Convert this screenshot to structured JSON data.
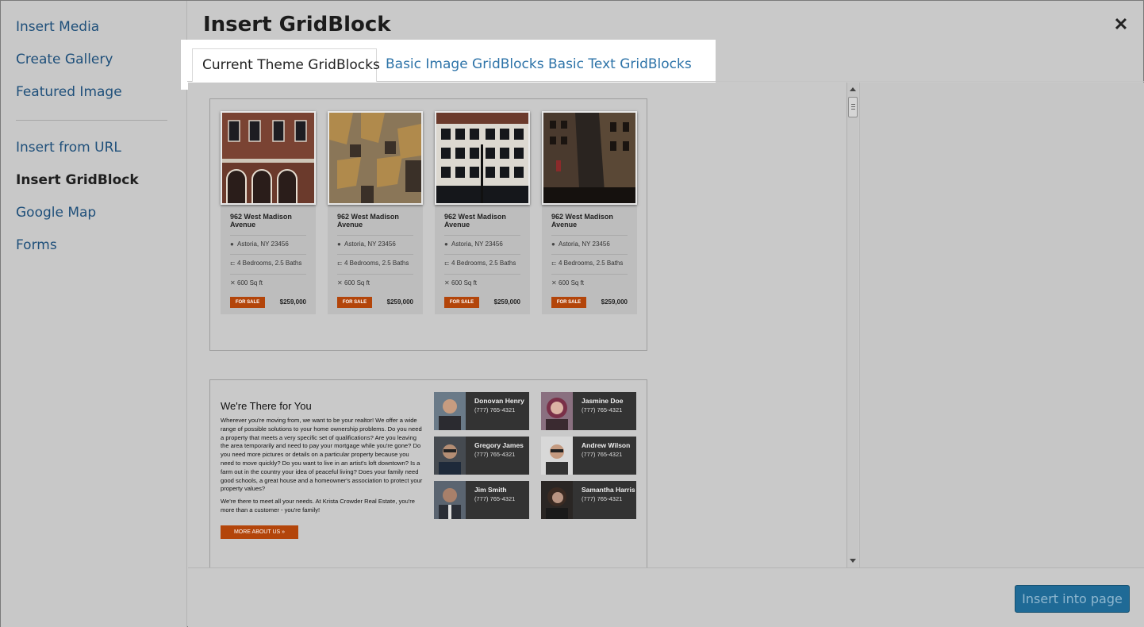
{
  "sidebar": {
    "items": [
      {
        "label": "Insert Media"
      },
      {
        "label": "Create Gallery"
      },
      {
        "label": "Featured Image"
      },
      {
        "label": "Insert from URL"
      },
      {
        "label": "Insert GridBlock",
        "active": true
      },
      {
        "label": "Google Map"
      },
      {
        "label": "Forms"
      }
    ]
  },
  "modal": {
    "title": "Insert GridBlock",
    "close_icon": "close-icon"
  },
  "tabs": [
    {
      "label": "Current Theme GridBlocks",
      "active": true
    },
    {
      "label": "Basic Image GridBlocks"
    },
    {
      "label": "Basic Text GridBlocks"
    }
  ],
  "listings": [
    {
      "address": "962 West Madison Avenue",
      "location": "Astoria, NY 23456",
      "rooms": "4 Bedrooms, 2.5 Baths",
      "area": "600 Sq ft",
      "badge": "FOR SALE",
      "price": "$259,000"
    },
    {
      "address": "962 West Madison Avenue",
      "location": "Astoria, NY 23456",
      "rooms": "4 Bedrooms, 2.5 Baths",
      "area": "600 Sq ft",
      "badge": "FOR SALE",
      "price": "$259,000"
    },
    {
      "address": "962 West Madison Avenue",
      "location": "Astoria, NY 23456",
      "rooms": "4 Bedrooms, 2.5 Baths",
      "area": "600 Sq ft",
      "badge": "FOR SALE",
      "price": "$259,000"
    },
    {
      "address": "962 West Madison Avenue",
      "location": "Astoria, NY 23456",
      "rooms": "4 Bedrooms, 2.5 Baths",
      "area": "600 Sq ft",
      "badge": "FOR SALE",
      "price": "$259,000"
    }
  ],
  "about": {
    "title": "We're There for You",
    "paragraph1": "Wherever you're moving from, we want to be your realtor! We offer a wide range of possible solutions to your home ownership problems. Do you need a property that meets a very specific set of qualifications? Are you leaving the area temporarily and need to pay your mortgage while you're gone? Do you need more pictures or details on a particular property because you need to move quickly? Do you want to live in an artist's loft downtown? Is a farm out in the country your idea of peaceful living? Does your family need good schools, a great house and a homeowner's association to protect your property values?",
    "paragraph2": "We're there to meet all your needs. At Krista Crowder Real Estate, you're more than a customer - you're family!",
    "button": "MORE ABOUT US »"
  },
  "agents": [
    {
      "name": "Donovan Henry",
      "phone": "(777) 765-4321"
    },
    {
      "name": "Jasmine Doe",
      "phone": "(777) 765-4321"
    },
    {
      "name": "Gregory James",
      "phone": "(777) 765-4321"
    },
    {
      "name": "Andrew Wilson",
      "phone": "(777) 765-4321"
    },
    {
      "name": "Jim Smith",
      "phone": "(777) 765-4321"
    },
    {
      "name": "Samantha Harris",
      "phone": "(777) 765-4321"
    }
  ],
  "footer": {
    "insert_button": "Insert into page"
  },
  "colors": {
    "accent_orange": "#b3450a",
    "primary_button": "#1f6a96",
    "link_blue": "#2d73a8"
  }
}
